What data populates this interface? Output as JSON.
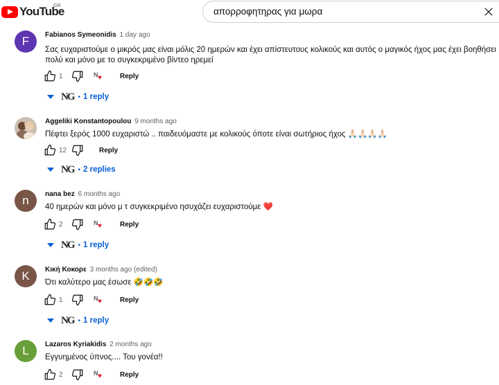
{
  "brand": {
    "name": "YouTube",
    "country": "GR",
    "color": "#ff0000"
  },
  "search": {
    "query": "απορροφητηρας για μωρα",
    "clear_icon": "close-icon"
  },
  "colors": {
    "link": "#065fd4",
    "heart": "#e01e35"
  },
  "comments": [
    {
      "author": "Fabianos Symeonidis",
      "time": "1 day ago",
      "avatar_letter": "F",
      "avatar_color": "#5e35b1",
      "text": "Σας ευχαριστούμε ο μικρός μας είναι μόλις 20 ημερών και έχει απίστευτους κολικούς και αυτός ο μαγικός ήχος μας έχει βοηθήσει\nπολύ και μόνο με το συγκεκριμένο βίντεο ηρεμεί",
      "likes": "1",
      "reply_label": "Reply",
      "hearted": true,
      "replies": "1 reply"
    },
    {
      "author": "Aggeliki Konstantopoulou",
      "time": "9 months ago",
      "avatar_letter": "",
      "avatar_color": "#d9cfc6",
      "text": "Πέφτει ξερός 1000 ευχαριστώ .. παιδευόμαστε με κολικούς όποτε είναι σωτήριος ήχος 🙏🏻🙏🏻🙏🏻🙏🏻",
      "likes": "12",
      "reply_label": "Reply",
      "hearted": false,
      "replies": "2 replies"
    },
    {
      "author": "nana bez",
      "time": "6 months ago",
      "avatar_letter": "n",
      "avatar_color": "#795548",
      "text": "40 ημερών και μόνο μ τ συγκεκριμένο ησυχάζει ευχαριστούμε ❤️",
      "likes": "2",
      "reply_label": "Reply",
      "hearted": true,
      "replies": "1 reply"
    },
    {
      "author": "Κική Κοκορε",
      "time": "3 months ago (edited)",
      "avatar_letter": "K",
      "avatar_color": "#795548",
      "text": "Ότι καλύτερο μας έσωσε 🤣🤣🤣",
      "likes": "1",
      "reply_label": "Reply",
      "hearted": true,
      "replies": "1 reply"
    },
    {
      "author": "Lazaros Kyriakidis",
      "time": "2 months ago",
      "avatar_letter": "L",
      "avatar_color": "#689f38",
      "text": "Εγγυημένος ύπνος.... Του γονέα!!",
      "likes": "2",
      "reply_label": "Reply",
      "hearted": true,
      "replies": ""
    }
  ]
}
